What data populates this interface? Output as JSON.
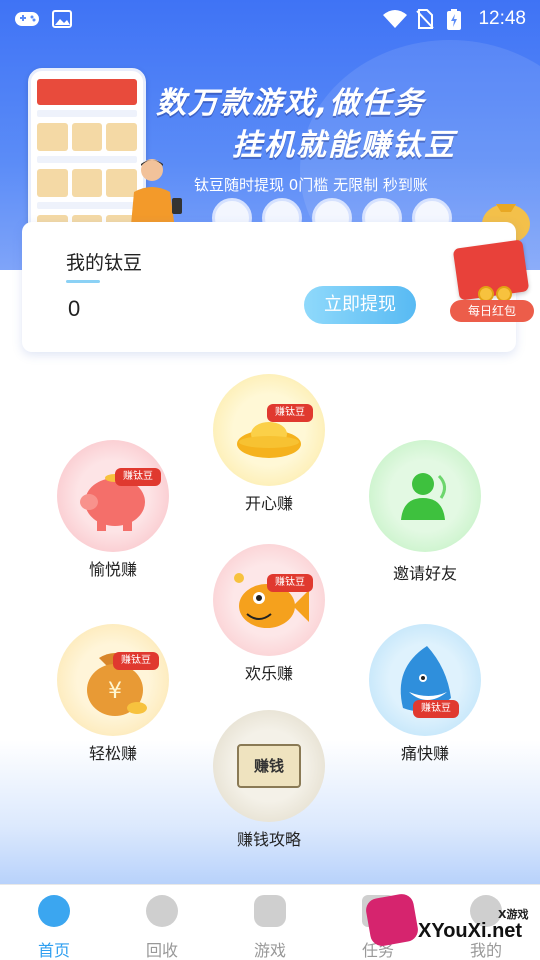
{
  "status_bar": {
    "time": "12:48"
  },
  "banner": {
    "slogan_line1": "数万款游戏,做任务",
    "slogan_line2": "挂机就能赚钛豆",
    "subslogan": "钛豆随时提现 0门槛 无限制 秒到账"
  },
  "balance_card": {
    "title": "我的钛豆",
    "value": "0",
    "withdraw_label": "立即提现"
  },
  "red_packet": {
    "label": "每日红包"
  },
  "earn_items": [
    {
      "label": "开心赚",
      "tag": "赚钛豆"
    },
    {
      "label": "愉悦赚",
      "tag": "赚钛豆"
    },
    {
      "label": "邀请好友"
    },
    {
      "label": "欢乐赚",
      "tag": "赚钛豆"
    },
    {
      "label": "轻松赚",
      "tag": "赚钛豆"
    },
    {
      "label": "痛快赚",
      "tag": "赚钛豆"
    },
    {
      "label": "赚钱攻略",
      "scroll_text": "赚钱"
    }
  ],
  "tabs": [
    {
      "label": "首页",
      "icon": "money-bag-icon",
      "active": true
    },
    {
      "label": "回收",
      "icon": "clock-icon"
    },
    {
      "label": "游戏",
      "icon": "gamepad-icon"
    },
    {
      "label": "任务",
      "icon": "task-icon"
    },
    {
      "label": "我的",
      "icon": "user-icon"
    }
  ],
  "watermark": {
    "small": "X游戏",
    "big": "XYouXi.net"
  },
  "colors": {
    "primary": "#3f73f5",
    "accent": "#3ba6f0",
    "tag_red": "#e0392f"
  }
}
